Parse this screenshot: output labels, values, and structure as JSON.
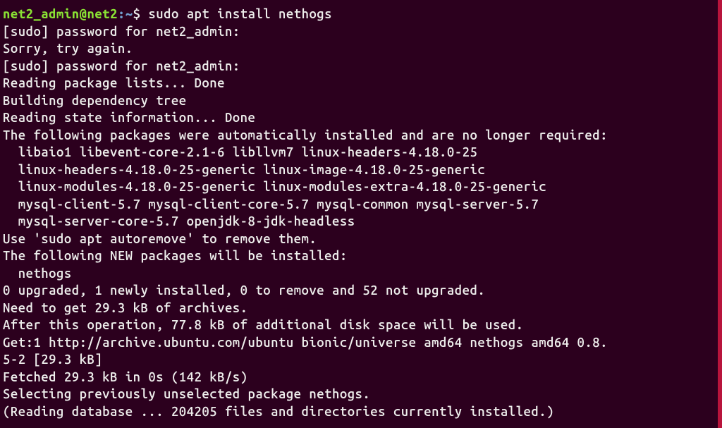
{
  "prompt": {
    "user": "net2_admin@net2",
    "sep": ":",
    "path": "~",
    "dollar": "$ "
  },
  "command": "sudo apt install nethogs",
  "lines": [
    "[sudo] password for net2_admin:",
    "Sorry, try again.",
    "[sudo] password for net2_admin:",
    "Reading package lists... Done",
    "Building dependency tree",
    "Reading state information... Done",
    "The following packages were automatically installed and are no longer required:",
    "  libaio1 libevent-core-2.1-6 libllvm7 linux-headers-4.18.0-25",
    "  linux-headers-4.18.0-25-generic linux-image-4.18.0-25-generic",
    "  linux-modules-4.18.0-25-generic linux-modules-extra-4.18.0-25-generic",
    "  mysql-client-5.7 mysql-client-core-5.7 mysql-common mysql-server-5.7",
    "  mysql-server-core-5.7 openjdk-8-jdk-headless",
    "Use 'sudo apt autoremove' to remove them.",
    "The following NEW packages will be installed:",
    "  nethogs",
    "0 upgraded, 1 newly installed, 0 to remove and 52 not upgraded.",
    "Need to get 29.3 kB of archives.",
    "After this operation, 77.8 kB of additional disk space will be used.",
    "Get:1 http://archive.ubuntu.com/ubuntu bionic/universe amd64 nethogs amd64 0.8.",
    "5-2 [29.3 kB]",
    "Fetched 29.3 kB in 0s (142 kB/s)",
    "Selecting previously unselected package nethogs.",
    "(Reading database ... 204205 files and directories currently installed.)"
  ]
}
